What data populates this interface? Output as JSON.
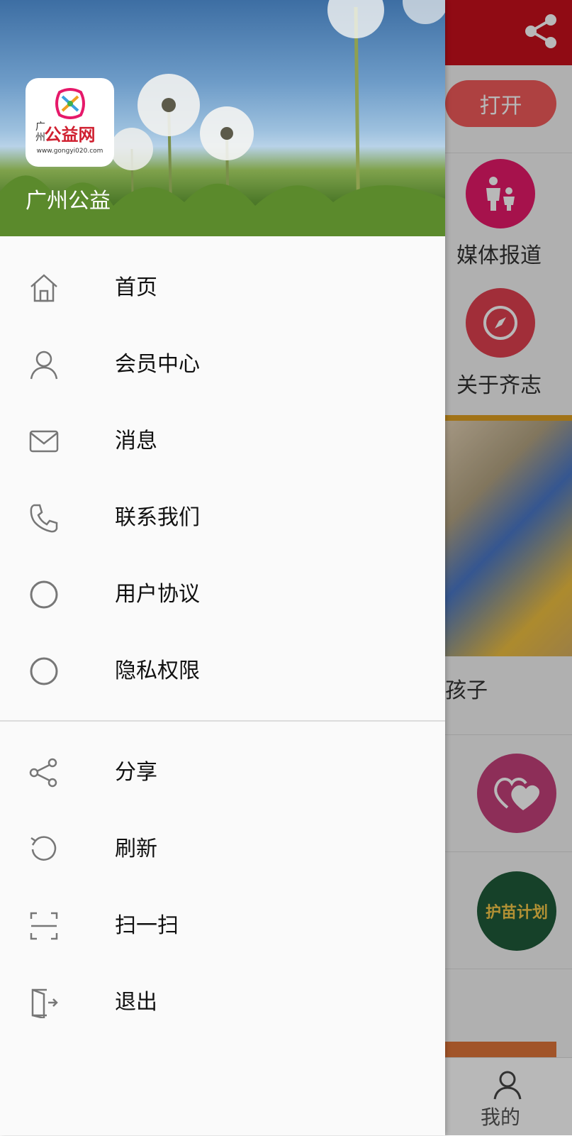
{
  "background": {
    "open_label": "打开",
    "items": [
      {
        "label": "媒体报道",
        "icon": "family-icon"
      },
      {
        "label": "关于齐志",
        "icon": "compass-icon"
      }
    ],
    "caption_partial": "孩子",
    "badge_text": "护苗计划",
    "nav_label": "我的",
    "colors": {
      "header": "#c8101c",
      "accent": "#e6196a"
    }
  },
  "drawer": {
    "logo": {
      "cn": "公益网",
      "city": "广州",
      "url": "www.gongyi020.com"
    },
    "app_name": "广州公益",
    "menu": [
      {
        "label": "首页",
        "icon": "home-icon"
      },
      {
        "label": "会员中心",
        "icon": "user-icon"
      },
      {
        "label": "消息",
        "icon": "mail-icon"
      },
      {
        "label": "联系我们",
        "icon": "phone-icon"
      },
      {
        "label": "用户协议",
        "icon": "circle-icon"
      },
      {
        "label": "隐私权限",
        "icon": "circle-icon"
      }
    ],
    "menu2": [
      {
        "label": "分享",
        "icon": "share-icon"
      },
      {
        "label": "刷新",
        "icon": "refresh-icon"
      },
      {
        "label": "扫一扫",
        "icon": "scan-icon"
      },
      {
        "label": "退出",
        "icon": "exit-icon"
      }
    ]
  }
}
